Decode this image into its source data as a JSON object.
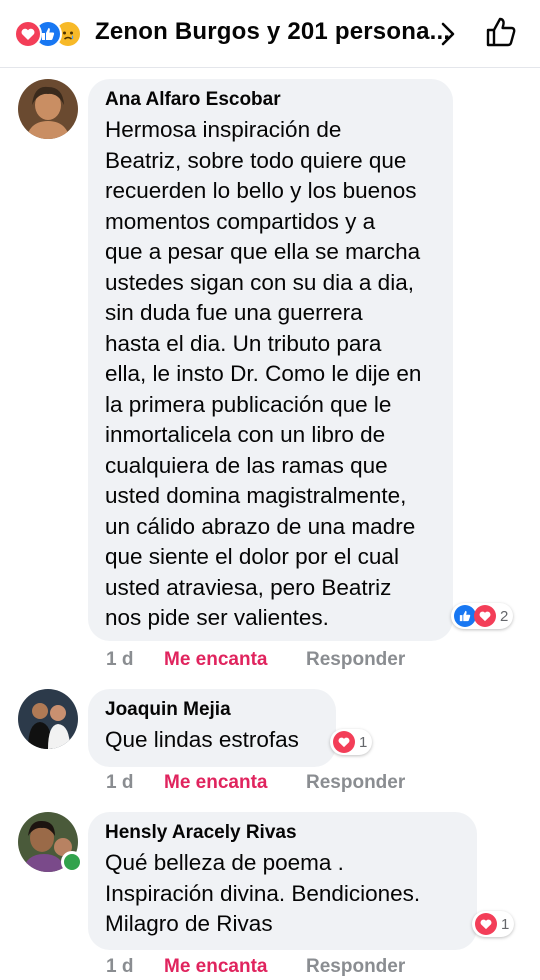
{
  "header": {
    "reaction_summary": "Zenon Burgos y 201 persona...",
    "reaction_icons": [
      "love-icon",
      "like-icon",
      "sad-icon"
    ]
  },
  "comments": [
    {
      "author": "Ana Alfaro Escobar",
      "text": "Hermosa inspiración de\nBeatriz, sobre todo quiere que\nrecuerden lo bello y los buenos\nmomentos compartidos y a\nque a pesar que ella se marcha\nustedes sigan con su dia a dia,\nsin duda fue una guerrera\nhasta el dia. Un tributo para\nella, le insto Dr. Como le dije en\nla primera publicación que le\ninmortalicela con un libro de\ncualquiera de las ramas que\nusted domina magistralmente,\nun cálido abrazo de una madre\nque siente el dolor por el cual\nusted atraviesa, pero Beatriz\nnos pide ser valientes.",
      "time": "1 d",
      "reaction_label": "Me encanta",
      "reply_label": "Responder",
      "reaction_count": "2"
    },
    {
      "author": "Joaquin Mejia",
      "text": "Que lindas estrofas",
      "time": "1 d",
      "reaction_label": "Me encanta",
      "reply_label": "Responder",
      "reaction_count": "1"
    },
    {
      "author": "Hensly Aracely Rivas",
      "text": "Qué  belleza de poema .\nInspiración  divina. Bendiciones.\nMilagro de Rivas",
      "time": "1 d",
      "reaction_label": "Me encanta",
      "reply_label": "Responder",
      "reaction_count": "1"
    }
  ],
  "colors": {
    "like_blue": "#1877f2",
    "love_red": "#f33e58",
    "love_label": "#e0245e",
    "bubble_bg": "#f0f2f5",
    "meta_gray": "#8a8d91",
    "online_green": "#31a24c"
  }
}
